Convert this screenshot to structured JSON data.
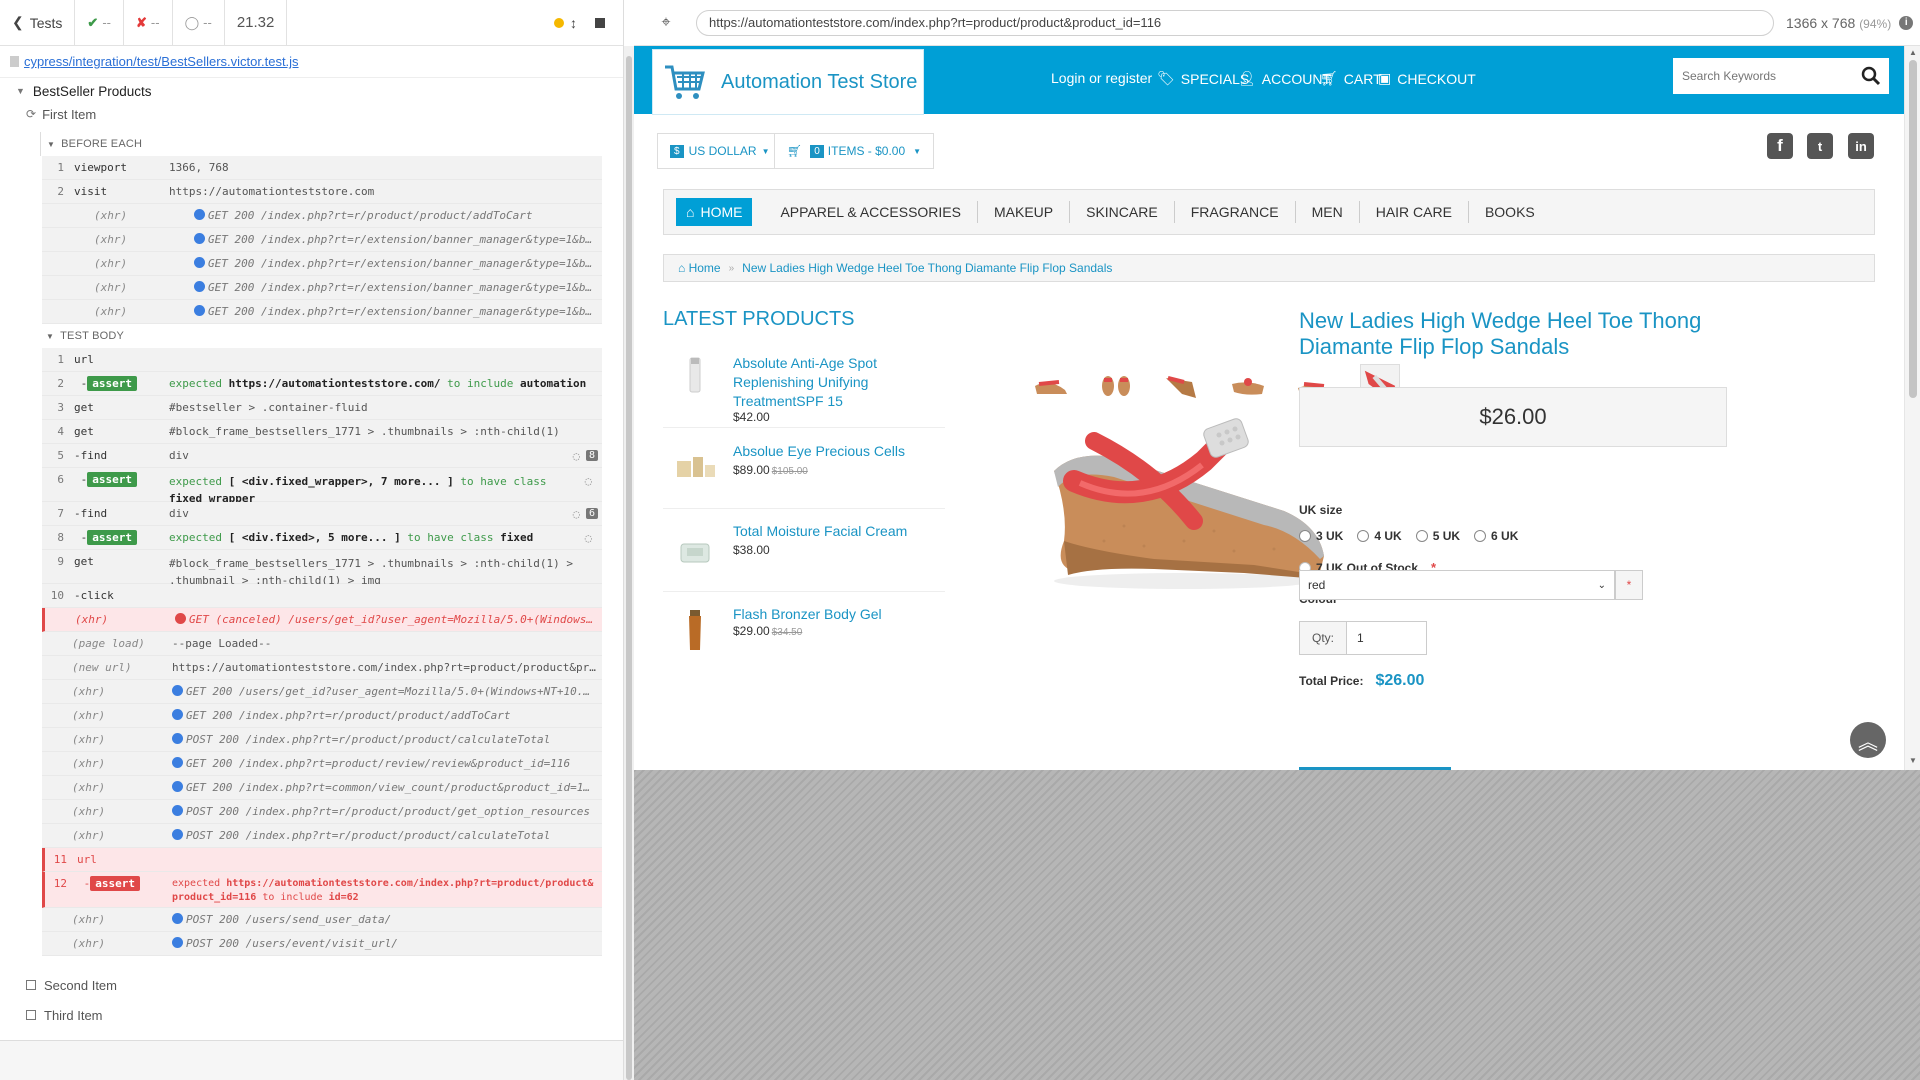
{
  "reporter": {
    "tests_label": "Tests",
    "passed": "--",
    "failed": "--",
    "pending": "--",
    "duration": "21.32",
    "spec_file": "cypress/integration/test/BestSellers.victor.test.js",
    "suite_title": "BestSeller Products",
    "test_title": "First Item",
    "before_each_title": "BEFORE EACH",
    "test_body_title": "TEST BODY",
    "before_each": [
      {
        "num": "1",
        "name": "viewport",
        "msg": "1366, 768"
      },
      {
        "num": "2",
        "name": "visit",
        "msg": "https://automationteststore.com"
      },
      {
        "num": "",
        "name": "(xhr)",
        "msg": "GET 200 /index.php?rt=r/product/product/addToCart"
      },
      {
        "num": "",
        "name": "(xhr)",
        "msg": "GET 200 /index.php?rt=r/extension/banner_manager&type=1&banner_i…"
      },
      {
        "num": "",
        "name": "(xhr)",
        "msg": "GET 200 /index.php?rt=r/extension/banner_manager&type=1&banner_i…"
      },
      {
        "num": "",
        "name": "(xhr)",
        "msg": "GET 200 /index.php?rt=r/extension/banner_manager&type=1&banner_i…"
      },
      {
        "num": "",
        "name": "(xhr)",
        "msg": "GET 200 /index.php?rt=r/extension/banner_manager&type=1&banner_i…"
      }
    ],
    "body": {
      "c1": {
        "num": "1",
        "name": "url"
      },
      "c2": {
        "num": "2",
        "name": "-assert",
        "badge": "assert",
        "expected": "expected",
        "val": "https://automationteststore.com/",
        "mid": "to include",
        "val2": "automation"
      },
      "c3": {
        "num": "3",
        "name": "get",
        "msg": "#bestseller > .container-fluid"
      },
      "c4": {
        "num": "4",
        "name": "get",
        "msg": "#block_frame_bestsellers_1771 > .thumbnails > :nth-child(1)"
      },
      "c5": {
        "num": "5",
        "name": "-find",
        "msg": "div",
        "count": "8"
      },
      "c6": {
        "num": "6",
        "name": "-assert",
        "badge": "assert",
        "expected": "expected",
        "val": "[ <div.fixed_wrapper>, 7 more... ]",
        "mid": "to have class",
        "val2": "fixed_wrapper"
      },
      "c7": {
        "num": "7",
        "name": "-find",
        "msg": "div",
        "count": "6"
      },
      "c8": {
        "num": "8",
        "name": "-assert",
        "badge": "assert",
        "expected": "expected",
        "val": "[ <div.fixed>, 5 more... ]",
        "mid": "to have class",
        "val2": "fixed"
      },
      "c9": {
        "num": "9",
        "name": "get",
        "msg": "#block_frame_bestsellers_1771 > .thumbnails > :nth-child(1) > .thumbnail > :nth-child(1) > img"
      },
      "c10": {
        "num": "10",
        "name": "-click"
      },
      "x1": {
        "name": "(xhr)",
        "msg": "GET (canceled) /users/get_id?user_agent=Mozilla/5.0+(Windows+NT+10.0;+Win64;…"
      },
      "x2": {
        "name": "(page load)",
        "msg": "--page Loaded--"
      },
      "x3": {
        "name": "(new url)",
        "msg": "https://automationteststore.com/index.php?rt=product/product&produ…"
      },
      "x4": {
        "name": "(xhr)",
        "msg": "GET 200 /users/get_id?user_agent=Mozilla/5.0+(Windows+NT+10.0;+Win64;+x64)+A…"
      },
      "x5": {
        "name": "(xhr)",
        "msg": "GET 200 /index.php?rt=r/product/product/addToCart"
      },
      "x6": {
        "name": "(xhr)",
        "msg": "POST 200 /index.php?rt=r/product/product/calculateTotal"
      },
      "x7": {
        "name": "(xhr)",
        "msg": "GET 200 /index.php?rt=product/review/review&product_id=116"
      },
      "x8": {
        "name": "(xhr)",
        "msg": "GET 200 /index.php?rt=common/view_count/product&product_id=116"
      },
      "x9": {
        "name": "(xhr)",
        "msg": "POST 200 /index.php?rt=r/product/product/get_option_resources"
      },
      "x10": {
        "name": "(xhr)",
        "msg": "POST 200 /index.php?rt=r/product/product/calculateTotal"
      },
      "c11": {
        "num": "11",
        "name": "url"
      },
      "c12": {
        "num": "12",
        "name": "-assert",
        "badge": "assert",
        "expected": "expected",
        "val": "https://automationteststore.com/index.php?rt=product/product&product_id=116",
        "mid": "to include",
        "val2": "id=62"
      },
      "x11": {
        "name": "(xhr)",
        "msg": "POST 200 /users/send_user_data/"
      },
      "x12": {
        "name": "(xhr)",
        "msg": "POST 200 /users/event/visit_url/"
      }
    },
    "other_tests": [
      "Second Item",
      "Third Item"
    ]
  },
  "browser": {
    "url": "https://automationteststore.com/index.php?rt=product/product&product_id=116",
    "viewport": "1366 x 768",
    "zoom": "(94%)"
  },
  "store": {
    "logo_text": "Automation Test Store",
    "login": "Login or register",
    "specials": "SPECIALS",
    "account": "ACCOUNT",
    "cart": "CART",
    "checkout": "CHECKOUT",
    "search_placeholder": "Search Keywords",
    "currency": "US DOLLAR",
    "currency_symbol": "$",
    "cart_count": "0",
    "cart_summary": "ITEMS - $0.00",
    "social": [
      "f",
      "t",
      "in"
    ],
    "nav": [
      "HOME",
      "APPAREL & ACCESSORIES",
      "MAKEUP",
      "SKINCARE",
      "FRAGRANCE",
      "MEN",
      "HAIR CARE",
      "BOOKS"
    ],
    "breadcrumb_home": "Home",
    "breadcrumb_current": "New Ladies High Wedge Heel Toe Thong Diamante Flip Flop Sandals",
    "latest_heading": "LATEST PRODUCTS",
    "latest": [
      {
        "name": "Absolute Anti-Age Spot Replenishing Unifying TreatmentSPF 15",
        "price": "$42.00",
        "old": ""
      },
      {
        "name": "Absolue Eye Precious Cells",
        "price": "$89.00",
        "old": "$105.00"
      },
      {
        "name": "Total Moisture Facial Cream",
        "price": "$38.00",
        "old": ""
      },
      {
        "name": "Flash Bronzer Body Gel",
        "price": "$29.00",
        "old": "$34.50"
      }
    ],
    "product_title": "New Ladies High Wedge Heel Toe Thong Diamante Flip Flop Sandals",
    "price": "$26.00",
    "uk_size_label": "UK size",
    "sizes": [
      "3 UK",
      "4 UK",
      "5 UK",
      "6 UK"
    ],
    "size_out": "7 UK Out of Stock",
    "required": "*",
    "colour_label": "Colour",
    "colour_value": "red",
    "qty_label": "Qty:",
    "qty_value": "1",
    "total_label": "Total Price:",
    "total_value": "$26.00"
  },
  "colors": {
    "brand_blue": "#009fd6",
    "link_blue": "#1a94c4",
    "pass_green": "#3e9a4a",
    "fail_red": "#e04848"
  }
}
